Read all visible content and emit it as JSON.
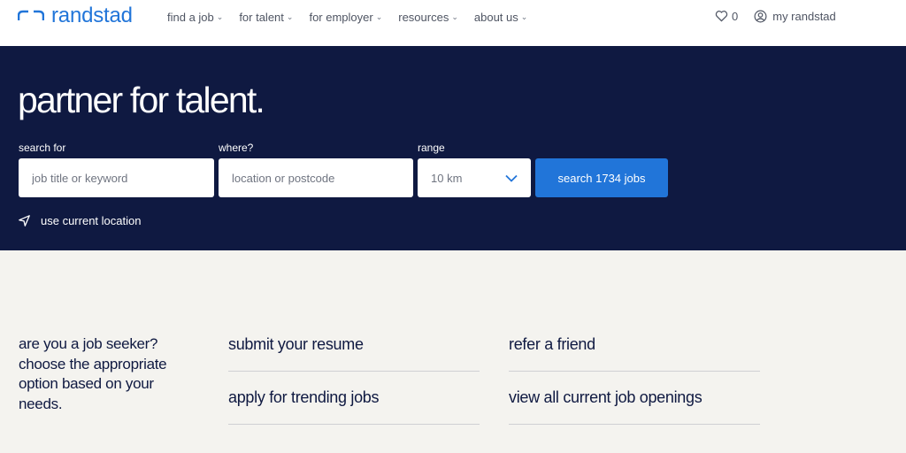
{
  "brand": {
    "name": "randstad",
    "accent": "#2175d9",
    "navy": "#0f1941"
  },
  "nav": {
    "items": [
      {
        "label": "find a job"
      },
      {
        "label": "for talent"
      },
      {
        "label": "for employer"
      },
      {
        "label": "resources"
      },
      {
        "label": "about us"
      }
    ],
    "favorites_count": "0",
    "account_label": "my randstad"
  },
  "hero": {
    "title": "partner for talent.",
    "search_label": "search for",
    "search_placeholder": "job title or keyword",
    "where_label": "where?",
    "where_placeholder": "location or postcode",
    "range_label": "range",
    "range_value": "10 km",
    "search_button": "search 1734 jobs",
    "use_location": "use current location"
  },
  "seeker": {
    "text": "are you a job seeker? choose the appropriate option based on your needs.",
    "links_col1": [
      {
        "label": "submit your resume"
      },
      {
        "label": "apply for trending jobs"
      }
    ],
    "links_col2": [
      {
        "label": "refer a friend"
      },
      {
        "label": "view all current job openings"
      }
    ]
  }
}
